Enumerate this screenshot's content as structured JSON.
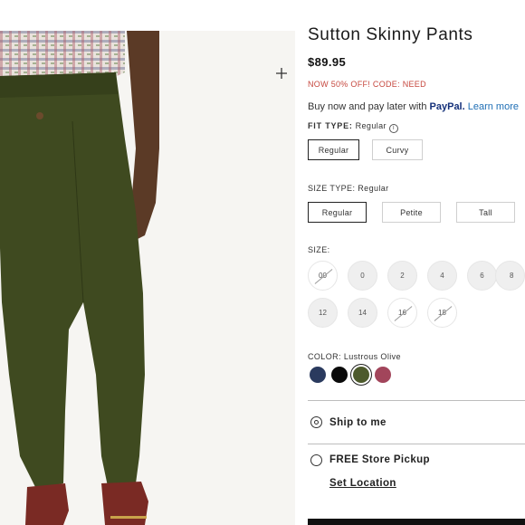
{
  "product": {
    "title": "Sutton Skinny Pants",
    "price": "$89.95",
    "promo": "NOW 50% OFF! CODE: NEED"
  },
  "paypal": {
    "prefix": "Buy now and pay later with ",
    "brand": "PayPal.",
    "link": "Learn more"
  },
  "fit": {
    "label": "FIT TYPE:",
    "selected": "Regular",
    "options": [
      "Regular",
      "Curvy"
    ]
  },
  "size_type": {
    "label": "SIZE TYPE:",
    "selected": "Regular",
    "options": [
      "Regular",
      "Petite",
      "Tall"
    ]
  },
  "sizes": {
    "label": "SIZE:",
    "row1": [
      "00",
      "0",
      "2",
      "4",
      "6",
      "8"
    ],
    "row2": [
      "12",
      "14",
      "16",
      "18"
    ],
    "unavailable": [
      "00",
      "16",
      "18"
    ]
  },
  "color": {
    "label": "COLOR:",
    "selected": "Lustrous Olive",
    "swatches": [
      "#2a3a5e",
      "#0a0a0a",
      "#4d5a2c",
      "#a2455b"
    ]
  },
  "fulfillment": {
    "ship": "Ship to me",
    "pickup": "FREE Store Pickup",
    "set_location": "Set Location"
  },
  "icons": {
    "zoom": "plus-icon",
    "info": "info-icon"
  }
}
